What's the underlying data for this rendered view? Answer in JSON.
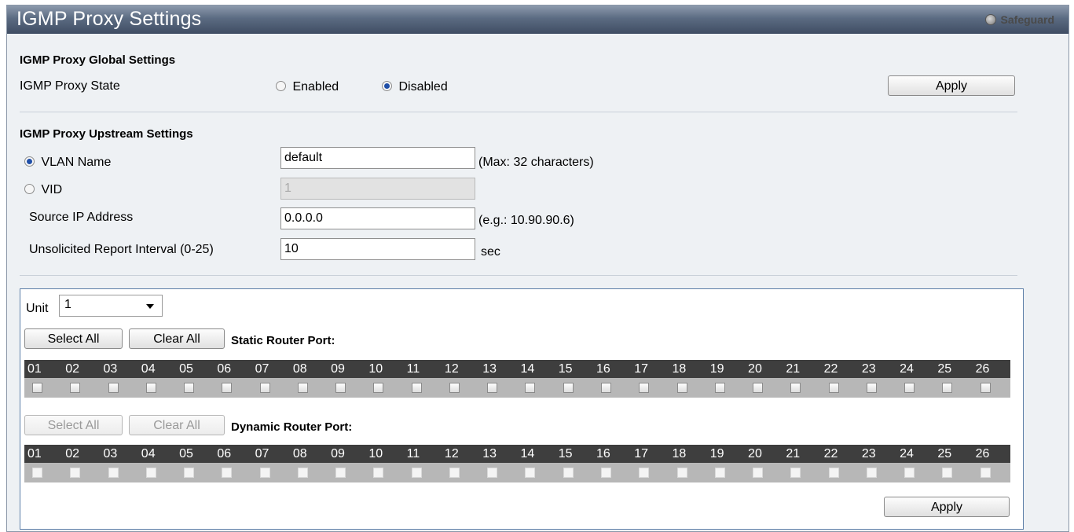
{
  "title": "IGMP Proxy Settings",
  "safeguard": "Safeguard",
  "global": {
    "header": "IGMP Proxy Global Settings",
    "state_label": "IGMP Proxy State",
    "enabled_label": "Enabled",
    "disabled_label": "Disabled",
    "selected": "Disabled",
    "apply_label": "Apply"
  },
  "upstream": {
    "header": "IGMP Proxy Upstream Settings",
    "vlan_name_label": "VLAN Name",
    "vlan_name_value": "default",
    "vlan_name_hint": "(Max: 32 characters)",
    "vid_label": "VID",
    "vid_value": "1",
    "source_ip_label": "Source IP Address",
    "source_ip_value": "0.0.0.0",
    "source_ip_hint": "(e.g.: 10.90.90.6)",
    "interval_label": "Unsolicited Report Interval (0-25)",
    "interval_value": "10",
    "interval_unit": "sec",
    "selected": "VLAN Name"
  },
  "ports": {
    "unit_label": "Unit",
    "unit_value": "1",
    "select_all_label": "Select All",
    "clear_all_label": "Clear All",
    "static_label": "Static Router Port:",
    "dynamic_label": "Dynamic Router Port:",
    "port_numbers": [
      "01",
      "02",
      "03",
      "04",
      "05",
      "06",
      "07",
      "08",
      "09",
      "10",
      "11",
      "12",
      "13",
      "14",
      "15",
      "16",
      "17",
      "18",
      "19",
      "20",
      "21",
      "22",
      "23",
      "24",
      "25",
      "26"
    ],
    "apply_label": "Apply"
  }
}
